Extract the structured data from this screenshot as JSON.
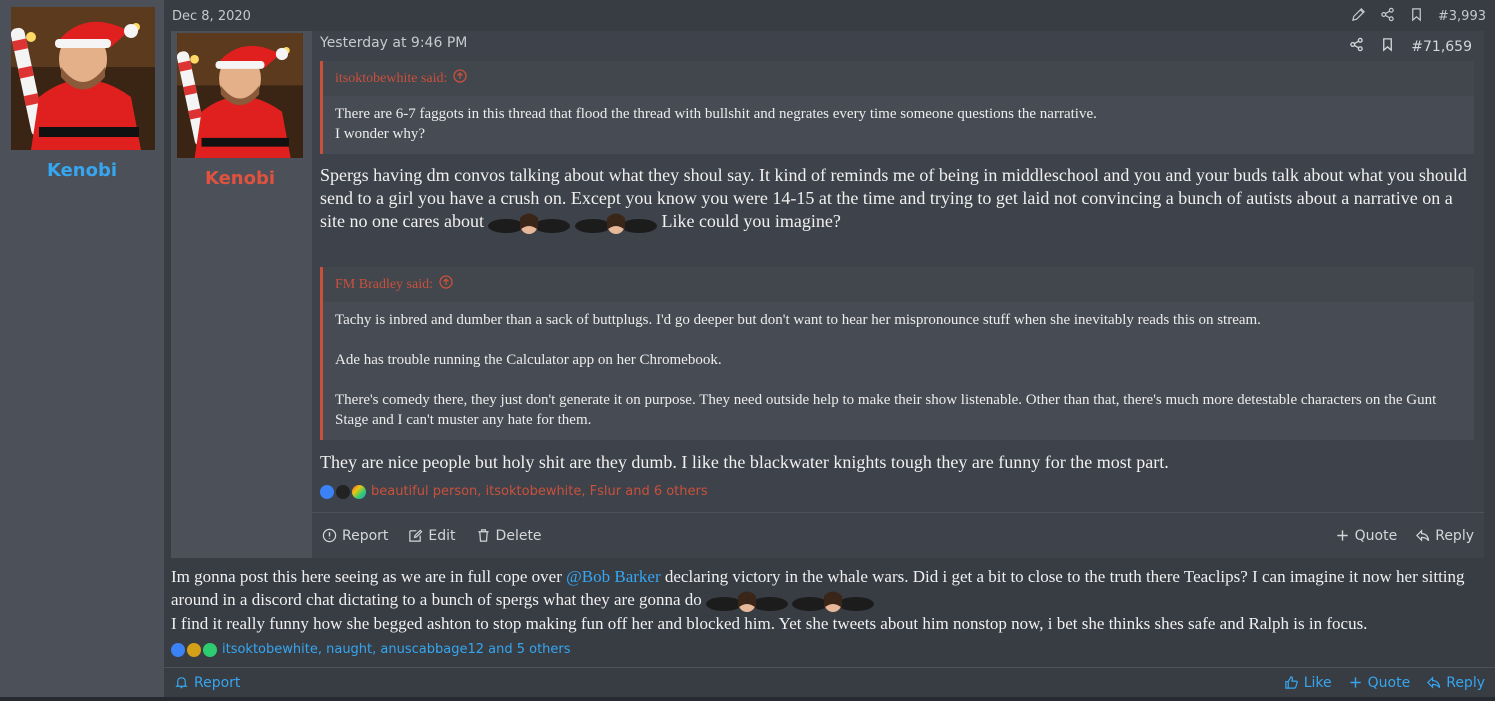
{
  "outer_post": {
    "username": "Kenobi",
    "date": "Dec 8, 2020",
    "post_number": "#3,993",
    "body": {
      "p1_a": "Im gonna post this here seeing as we are in full cope over ",
      "mention": "@Bob Barker",
      "p1_b": " declaring victory in the whale wars. Did i get a bit to close to the truth there Teaclips? I can imagine it now her sitting around in a discord chat dictating to a bunch of spergs what they are gonna do",
      "p2": "I find it really funny how she begged ashton to stop making fun off her and blocked him. Yet she tweets about him nonstop now, i bet she thinks shes safe and Ralph is in focus."
    },
    "reactions": "itsoktobewhite, naught, anuscabbage12 and 5 others",
    "footer": {
      "report": "Report",
      "like": "Like",
      "quote": "Quote",
      "reply": "Reply"
    }
  },
  "inner_post": {
    "username": "Kenobi",
    "date": "Yesterday at 9:46 PM",
    "post_number": "#71,659",
    "quote1": {
      "author": "itsoktobewhite said:",
      "lines": [
        "There are 6-7 faggots in this thread that flood the thread with bullshit and negrates every time someone questions the narrative.",
        "I wonder why?"
      ]
    },
    "text1": "Spergs having dm convos talking about what they shoul say. It kind of reminds me of being in middleschool and you and your buds talk about what you should send to a girl you have a crush on. Except you know you were 14-15 at the time and trying to get laid not convincing a bunch of autists about a narrative on a site no one cares about",
    "text1_end": "Like could you imagine?",
    "quote2": {
      "author": "FM Bradley said:",
      "p1": "Tachy is inbred and dumber than a sack of buttplugs. I'd go deeper but don't want to hear her mispronounce stuff when she inevitably reads this on stream.",
      "p2": "Ade has trouble running the Calculator app on her Chromebook.",
      "p3": "There's comedy there, they just don't generate it on purpose. They need outside help to make their show listenable. Other than that, there's much more detestable characters on the Gunt Stage and I can't muster any hate for them."
    },
    "text2": "They are nice people but holy shit are they dumb. I like the blackwater knights tough they are funny for the most part.",
    "reactions": "beautiful person, itsoktobewhite, Fslur and 6 others",
    "footer": {
      "report": "Report",
      "edit": "Edit",
      "delete": "Delete",
      "quote": "Quote",
      "reply": "Reply"
    }
  },
  "colors": {
    "link_blue": "#36a6f0",
    "quote_red": "#c9513c",
    "username_red": "#e0523e"
  },
  "icons": [
    "pencil-icon",
    "share-icon",
    "bookmark-icon",
    "arrow-up-circle-icon",
    "info-circle-icon",
    "edit-icon",
    "trash-icon",
    "plus-icon",
    "reply-icon",
    "thumbs-up-icon",
    "bell-icon"
  ]
}
